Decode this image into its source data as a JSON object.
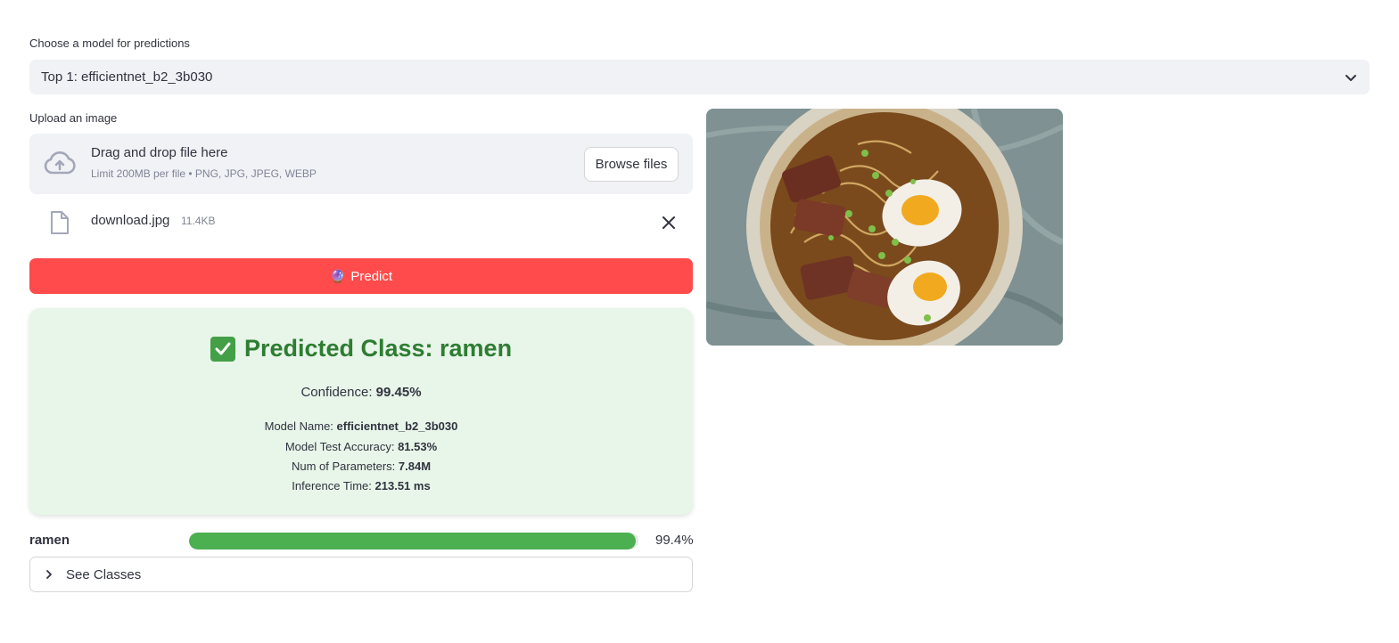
{
  "model_select": {
    "label": "Choose a model for predictions",
    "value": "Top 1: efficientnet_b2_3b030"
  },
  "uploader": {
    "label": "Upload an image",
    "drop_title": "Drag and drop file here",
    "drop_subtitle": "Limit 200MB per file • PNG, JPG, JPEG, WEBP",
    "browse_label": "Browse files",
    "file_name": "download.jpg",
    "file_size": "11.4KB"
  },
  "predict_button": {
    "emoji": "🔮",
    "label": "Predict"
  },
  "result": {
    "title": "Predicted Class: ramen",
    "confidence_label": "Confidence: ",
    "confidence_value": "99.45%",
    "model_name_label": "Model Name: ",
    "model_name_value": "efficientnet_b2_3b030",
    "accuracy_label": "Model Test Accuracy: ",
    "accuracy_value": "81.53%",
    "params_label": "Num of Parameters: ",
    "params_value": "7.84M",
    "inference_label": "Inference Time: ",
    "inference_value": "213.51 ms"
  },
  "probability": {
    "class_name": "ramen",
    "percent_text": "99.4%",
    "fraction": 0.994
  },
  "expander": {
    "label": "See Classes"
  },
  "colors": {
    "primary": "#ff4b4b",
    "success_bg": "#e8f5e9",
    "success_text": "#2e7d32",
    "bar_fill": "#4caf50"
  },
  "icons": [
    "chevron-down-icon",
    "cloud-upload-icon",
    "file-icon",
    "close-icon",
    "chevron-right-icon",
    "check-icon"
  ]
}
